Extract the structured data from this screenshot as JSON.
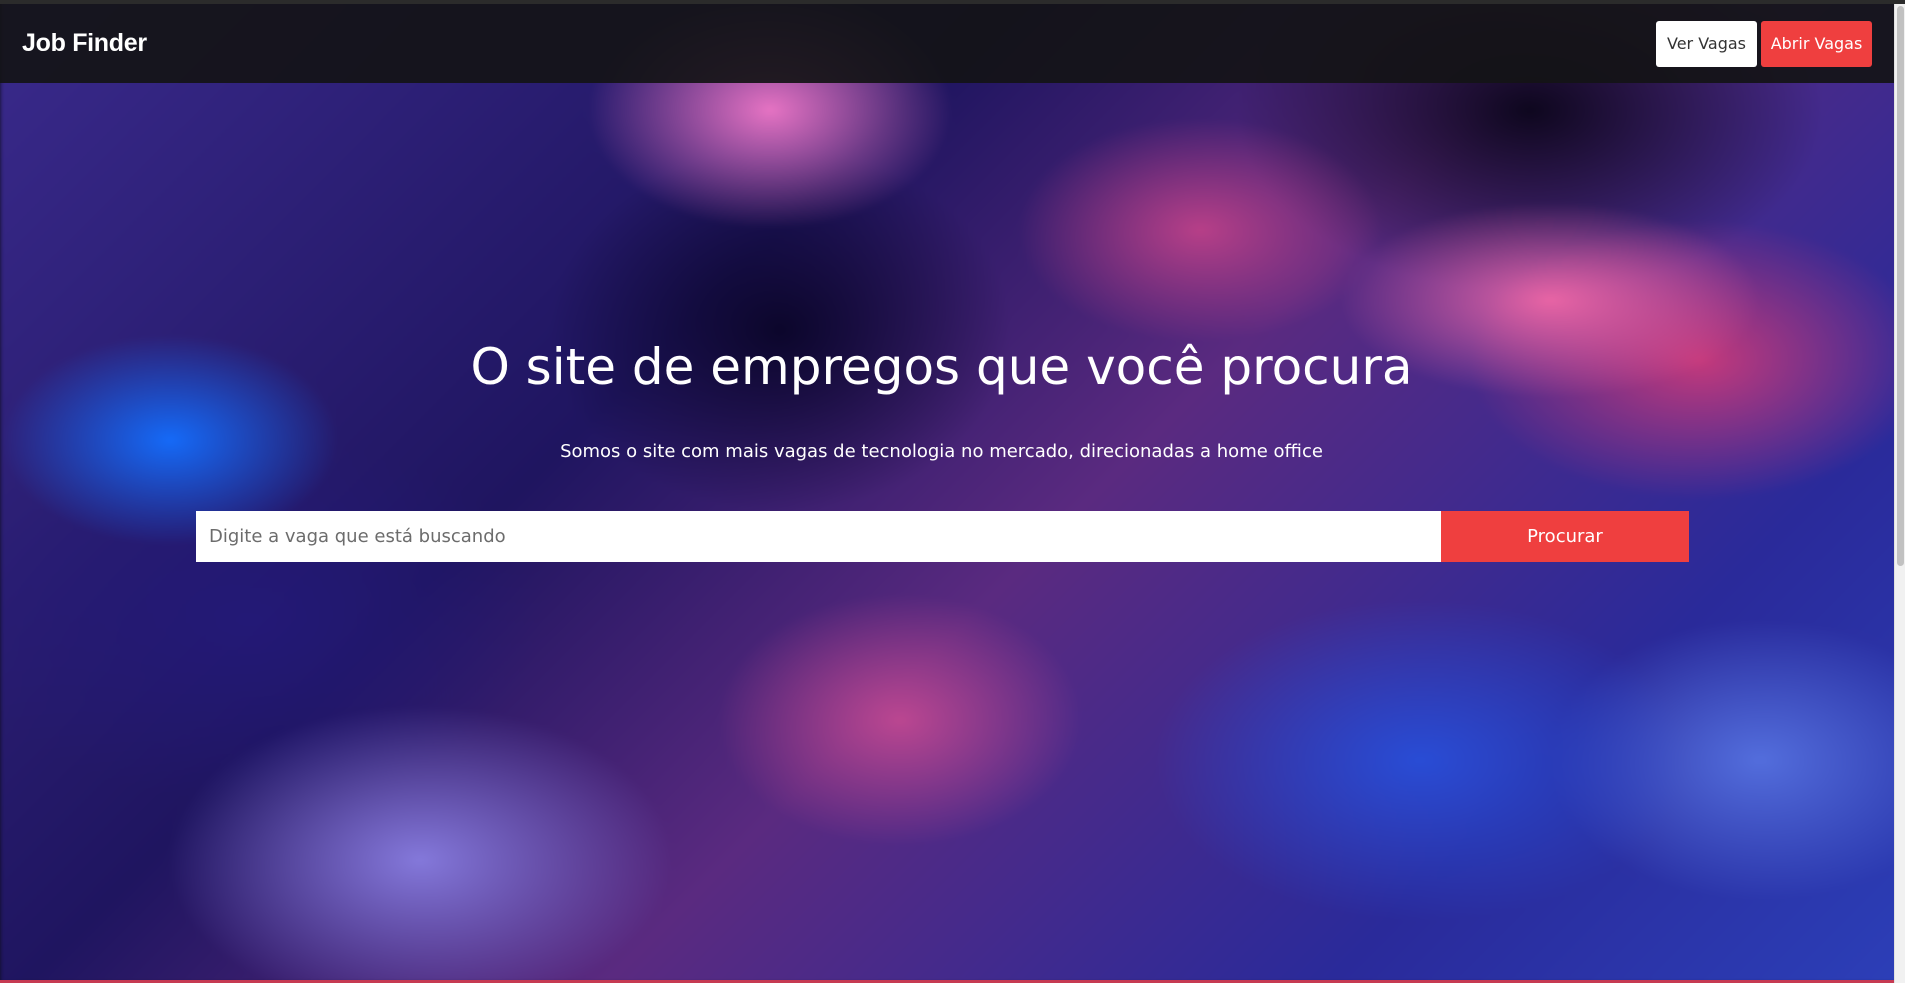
{
  "navbar": {
    "brand": "Job Finder",
    "ver_vagas_label": "Ver Vagas",
    "abrir_vagas_label": "Abrir Vagas"
  },
  "hero": {
    "title": "O site de empregos que você procura",
    "subtitle": "Somos o site com mais vagas de tecnologia no mercado, direcionadas a home office"
  },
  "search": {
    "placeholder": "Digite a vaga que está buscando",
    "value": "",
    "button_label": "Procurar"
  },
  "colors": {
    "navbar_bg": "#141416",
    "accent": "#ef3f3f",
    "text_light": "#ffffff"
  }
}
